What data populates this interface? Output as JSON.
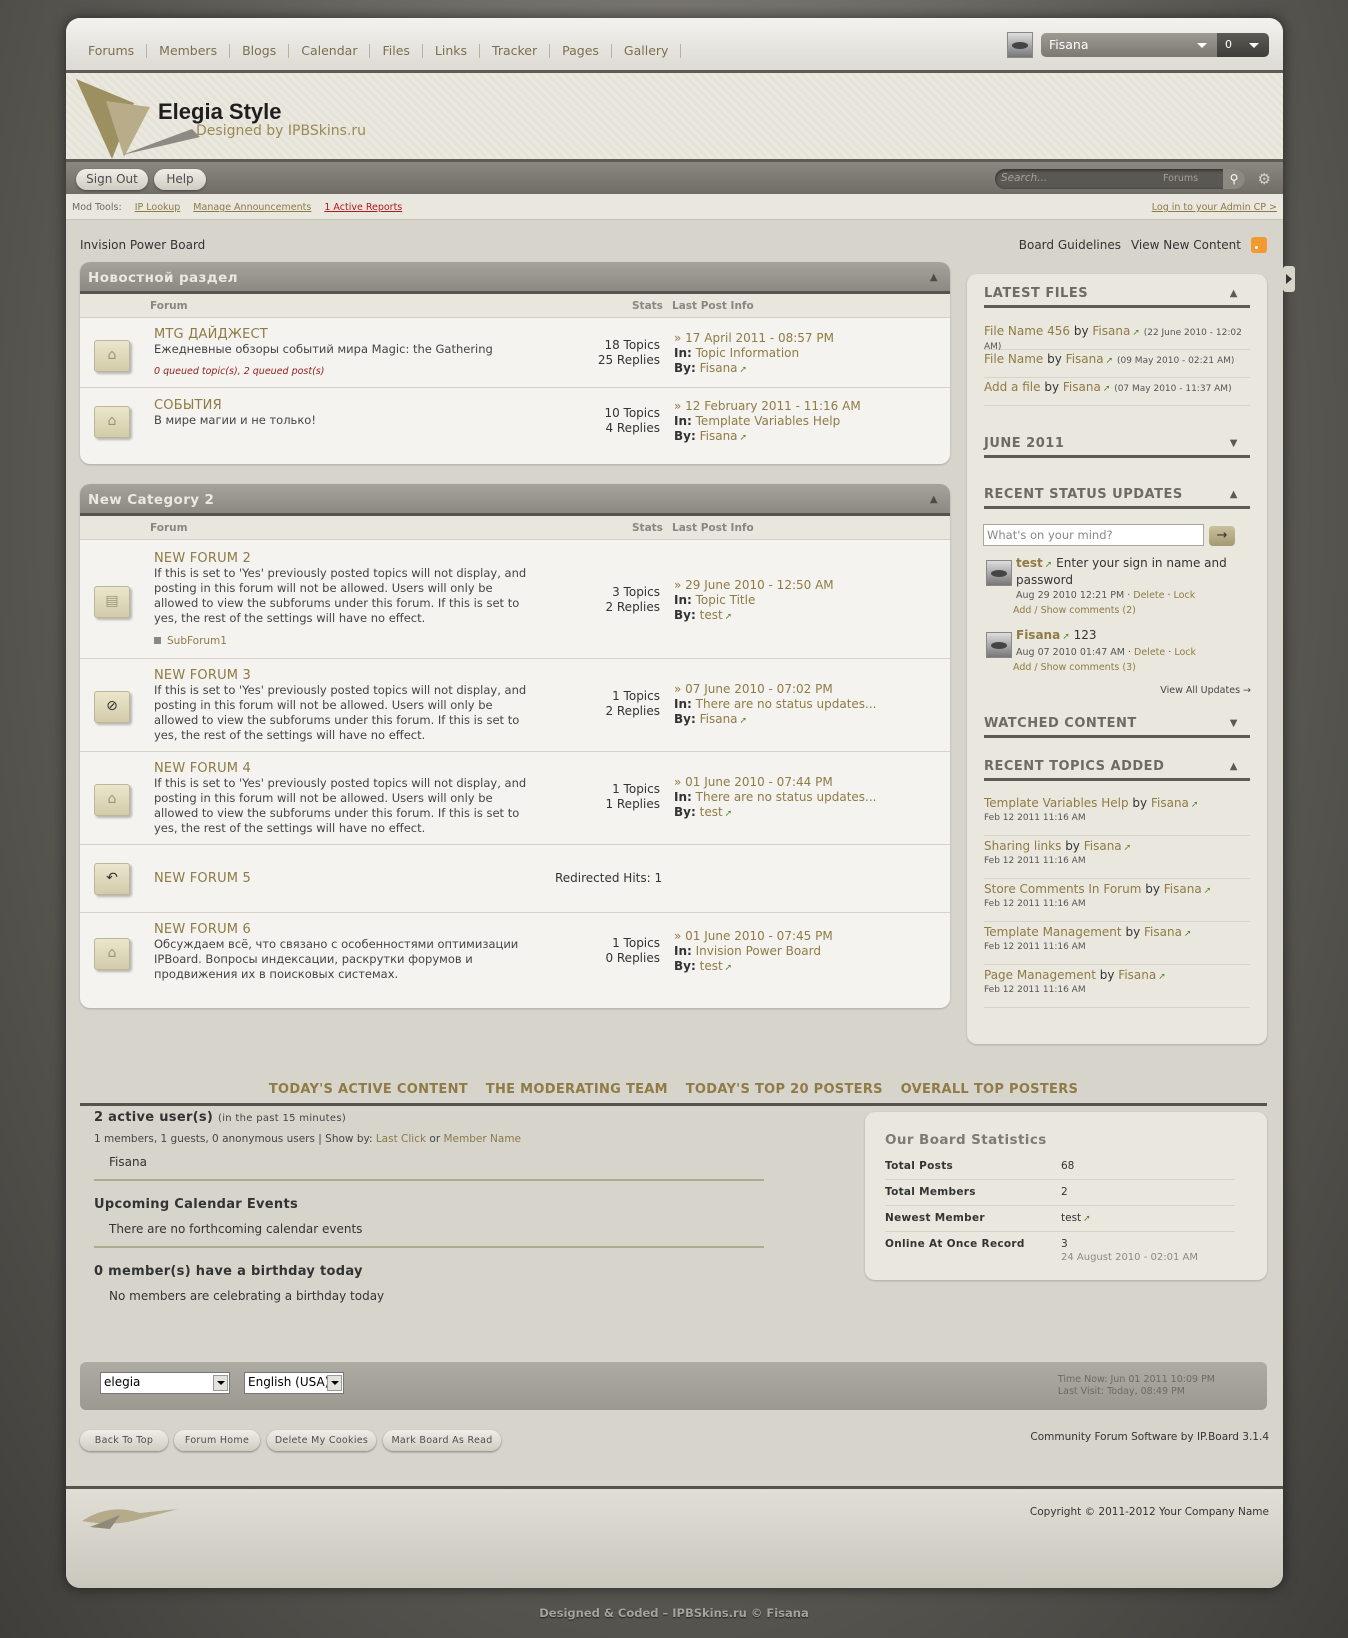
{
  "topnav": [
    "Forums",
    "Members",
    "Blogs",
    "Calendar",
    "Files",
    "Links",
    "Tracker",
    "Pages",
    "Gallery"
  ],
  "user": {
    "name": "Fisana",
    "notifications": "0"
  },
  "logo": {
    "title": "Elegia Style",
    "subtitle": "Designed by IPBSkins.ru"
  },
  "toolbar": {
    "signout": "Sign Out",
    "help": "Help",
    "search_placeholder": "Search...",
    "search_scope": "Forums",
    "search_go": "🔍"
  },
  "modtools": {
    "label": "Mod Tools:",
    "ip": "IP Lookup",
    "announce": "Manage Announcements",
    "reports": "1 Active Reports",
    "admin": "Log in to your Admin CP >"
  },
  "breadcrumb": "Invision Power Board",
  "toplinks": {
    "guidelines": "Board Guidelines",
    "newcontent": "View New Content"
  },
  "columns": {
    "forum": "Forum",
    "stats": "Stats",
    "last": "Last Post Info"
  },
  "categories": [
    {
      "title": "Новостной раздел",
      "forums": [
        {
          "title": "MTG ДАЙДЖЕСТ",
          "desc": "Ежедневные обзоры событий мира Magic: the Gathering",
          "queued": "0 queued topic(s), 2 queued post(s)",
          "topics": "18 Topics",
          "replies": "25 Replies",
          "date": "17 April 2011 - 08:57 PM",
          "in": "Topic Information",
          "by": "Fisana"
        },
        {
          "title": "СОБЫТИЯ",
          "desc": "В мире магии и не только!",
          "topics": "10 Topics",
          "replies": "4 Replies",
          "date": "12 February 2011 - 11:16 AM",
          "in": "Template Variables Help",
          "by": "Fisana"
        }
      ]
    },
    {
      "title": "New Category 2",
      "forums": [
        {
          "title": "NEW FORUM 2",
          "desc": "If this is set to 'Yes' previously posted topics will not display, and posting in this forum will not be allowed. Users will only be allowed to view the subforums under this forum. If this is set to yes, the rest of the settings will have no effect.",
          "sub": "SubForum1",
          "topics": "3 Topics",
          "replies": "2 Replies",
          "date": "29 June 2010 - 12:50 AM",
          "in": "Topic Title",
          "by": "test"
        },
        {
          "title": "NEW FORUM 3",
          "desc": "If this is set to 'Yes' previously posted topics will not display, and posting in this forum will not be allowed. Users will only be allowed to view the subforums under this forum. If this is set to yes, the rest of the settings will have no effect.",
          "topics": "1 Topics",
          "replies": "2 Replies",
          "date": "07 June 2010 - 07:02 PM",
          "in": "There are no status updates...",
          "by": "Fisana"
        },
        {
          "title": "NEW FORUM 4",
          "desc": "If this is set to 'Yes' previously posted topics will not display, and posting in this forum will not be allowed. Users will only be allowed to view the subforums under this forum. If this is set to yes, the rest of the settings will have no effect.",
          "topics": "1 Topics",
          "replies": "1 Replies",
          "date": "01 June 2010 - 07:44 PM",
          "in": "There are no status updates...",
          "by": "test"
        },
        {
          "title": "NEW FORUM 5",
          "redirect": "Redirected Hits: 1"
        },
        {
          "title": "NEW FORUM 6",
          "desc": "Обсуждаем всё, что связано с особенностями оптимизации IPBoard. Вопросы индексации, раскрутки форумов и продвижения их в поисковых системах.",
          "topics": "1 Topics",
          "replies": "0 Replies",
          "date": "01 June 2010 - 07:45 PM",
          "in": "Invision Power Board",
          "by": "test"
        }
      ]
    }
  ],
  "labels": {
    "in": "In:",
    "by": "By:"
  },
  "sidebar": {
    "latest_files": {
      "title": "LATEST FILES",
      "items": [
        {
          "name": "File Name 456",
          "by": "by",
          "user": "Fisana",
          "date": "(22 June 2010 - 12:02 AM)"
        },
        {
          "name": "File Name",
          "by": "by",
          "user": "Fisana",
          "date": "(09 May 2010 - 02:21 AM)"
        },
        {
          "name": "Add a file",
          "by": "by",
          "user": "Fisana",
          "date": "(07 May 2010 - 11:37 AM)"
        }
      ]
    },
    "calendar": {
      "title": "JUNE 2011"
    },
    "status": {
      "title": "RECENT STATUS UPDATES",
      "placeholder": "What's on your mind?",
      "go": "→",
      "items": [
        {
          "user": "test",
          "text": "Enter your sign in name and password",
          "date": "Aug 29 2010 12:21 PM",
          "delete": "Delete",
          "lock": "Lock",
          "comments": "Add / Show comments (2)"
        },
        {
          "user": "Fisana",
          "text": "123",
          "date": "Aug 07 2010 01:47 AM",
          "delete": "Delete",
          "lock": "Lock",
          "comments": "Add / Show comments (3)"
        }
      ],
      "viewall": "View All Updates →"
    },
    "watched": {
      "title": "WATCHED CONTENT"
    },
    "recent_topics": {
      "title": "RECENT TOPICS ADDED",
      "items": [
        {
          "topic": "Template Variables Help",
          "by": "by",
          "user": "Fisana",
          "date": "Feb 12 2011 11:16 AM"
        },
        {
          "topic": "Sharing links",
          "by": "by",
          "user": "Fisana",
          "date": "Feb 12 2011 11:16 AM"
        },
        {
          "topic": "Store Comments In Forum",
          "by": "by",
          "user": "Fisana",
          "date": "Feb 12 2011 11:16 AM"
        },
        {
          "topic": "Template Management",
          "by": "by",
          "user": "Fisana",
          "date": "Feb 12 2011 11:16 AM"
        },
        {
          "topic": "Page Management",
          "by": "by",
          "user": "Fisana",
          "date": "Feb 12 2011 11:16 AM"
        }
      ]
    }
  },
  "stat_tabs": [
    "TODAY'S ACTIVE CONTENT",
    "THE MODERATING TEAM",
    "TODAY'S TOP 20 POSTERS",
    "OVERALL TOP POSTERS"
  ],
  "active_users": {
    "title": "2 active user(s)",
    "period": "(in the past 15 minutes)",
    "summary": "1 members, 1 guests, 0 anonymous users | Show by:",
    "last_click": "Last Click",
    "or": "or",
    "member_name": "Member Name",
    "user": "Fisana"
  },
  "calendar_events": {
    "title": "Upcoming Calendar Events",
    "text": "There are no forthcoming calendar events"
  },
  "birthdays": {
    "title": "0 member(s) have a birthday today",
    "text": "No members are celebrating a birthday today"
  },
  "board_stats": {
    "title": "Our Board Statistics",
    "rows": [
      {
        "k": "Total Posts",
        "v": "68"
      },
      {
        "k": "Total Members",
        "v": "2"
      },
      {
        "k": "Newest Member",
        "v": "test"
      },
      {
        "k": "Online At Once Record",
        "v": "3",
        "v2": "24 August 2010 - 02:01 AM"
      }
    ]
  },
  "footer": {
    "skin": "elegia",
    "lang": "English (USA)",
    "time_now": "Time Now: Jun 01 2011 10:09 PM",
    "last_visit": "Last Visit: Today, 08:49 PM",
    "buttons": [
      "Back To Top",
      "Forum Home",
      "Delete My Cookies",
      "Mark Board As Read"
    ],
    "powered": "Community Forum Software by IP.Board 3.1.4",
    "copyright": "Copyright © 2011-2012 Your Company Name",
    "credit": "Designed & Coded – IPBSkins.ru © Fisana"
  }
}
